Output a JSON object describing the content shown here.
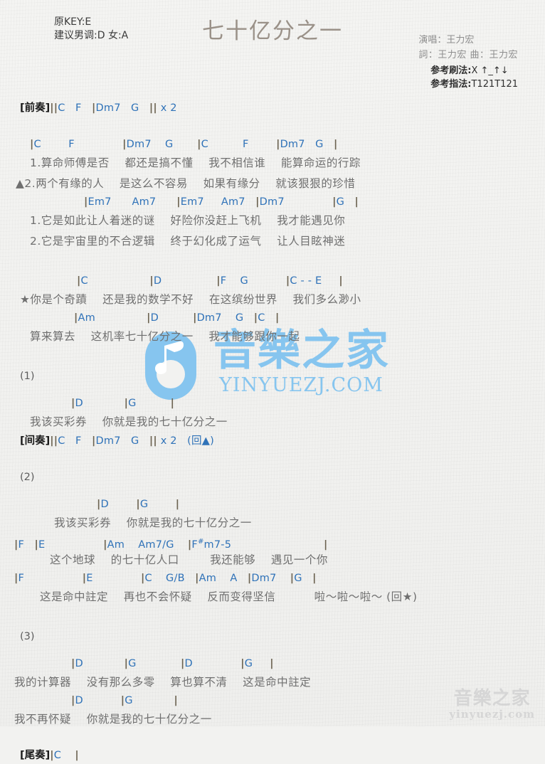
{
  "header": {
    "original_key": "原KEY:E",
    "suggested_key": "建议男调:D 女:A",
    "title": "七十亿分之一",
    "singer": "演唱：王力宏",
    "writers": "詞：王力宏  曲：王力宏",
    "strum_label": "参考刷法:",
    "strum_value": "X ↑_↑↓",
    "fingering_label": "参考指法:",
    "fingering_value": "T121T121"
  },
  "intro": {
    "label": "[前奏]",
    "chords": "||C   F   |Dm7   G   || x 2"
  },
  "verse1": {
    "chordline1": "|C        F              |Dm7    G       |C          F        |Dm7   G   |",
    "lyric1": "1.算命师傅是否    都还是搞不懂    我不相信谁    能算命运的行踪",
    "lyric2": "▲2.两个有缘的人    是这么不容易    如果有缘分    就该狠狠的珍惜",
    "chordline2": "|Em7      Am7      |Em7     Am7   |Dm7              |G   |",
    "lyric3": "1.它是如此让人着迷的谜    好险你没赶上飞机    我才能遇见你",
    "lyric4": "2.它是宇宙里的不合逻辑    终于幻化成了运气    让人目眩神迷"
  },
  "chorus": {
    "chordline1": "|C                  |D                |F    G           |C - - E     |",
    "lyric1": "★你是个奇蹟    还是我的数学不好    在这缤纷世界    我们多么渺小",
    "chordline2": "|Am               |D          |Dm7    G   |C   |",
    "lyric2": "算来算去    这机率七十亿分之一    我才能够跟你一起"
  },
  "section1": {
    "number": "(1)",
    "chordline": "|D            |G          |",
    "lyric": "我该买彩券    你就是我的七十亿分之一",
    "interlude_label": "[间奏]",
    "interlude_chords": "||C   F   |Dm7   G   || x 2   (回▲)"
  },
  "section2": {
    "number": "(2)",
    "chordline1": "|D        |G        |",
    "lyric1": "我该买彩券    你就是我的七十亿分之一",
    "chordline2": "|F   |E                 |Am    Am7/G    |F#m7-5                    |",
    "chordline2_parts": {
      "pre": "|F   |E                 |Am    Am7/G    |F",
      "sharp": "#",
      "post": "m7-5                           |"
    },
    "lyric2": "这个地球    的七十亿人口        我还能够    遇见一个你",
    "chordline3": "|F                 |E              |C    G/B   |Am    A   |Dm7    |G   |",
    "lyric3": "这是命中註定    再也不会怀疑    反而变得坚信          啦～啦～啦～ (回★)"
  },
  "section3": {
    "number": "(3)",
    "chordline1": "|D            |G             |D              |G     |",
    "lyric1": "我的计算器    没有那么多零    算也算不清    这是命中註定",
    "chordline2": "|D           |G            |",
    "lyric2": "我不再怀疑    你就是我的七十亿分之一"
  },
  "outro": {
    "label": "[尾奏]",
    "chords": "|C    |"
  },
  "watermarks": {
    "center_text": "音樂之家",
    "center_url": "YINYUEZJ.COM",
    "corner_cn": "音樂之家",
    "corner_url": "yinyuezj.com"
  },
  "colors": {
    "chord": "#2f72b8",
    "lyric": "#6f6f6f",
    "bar": "#6b6250",
    "title": "#9a9188",
    "watermark": "#86c5ef",
    "background": "#f2f2f0"
  }
}
